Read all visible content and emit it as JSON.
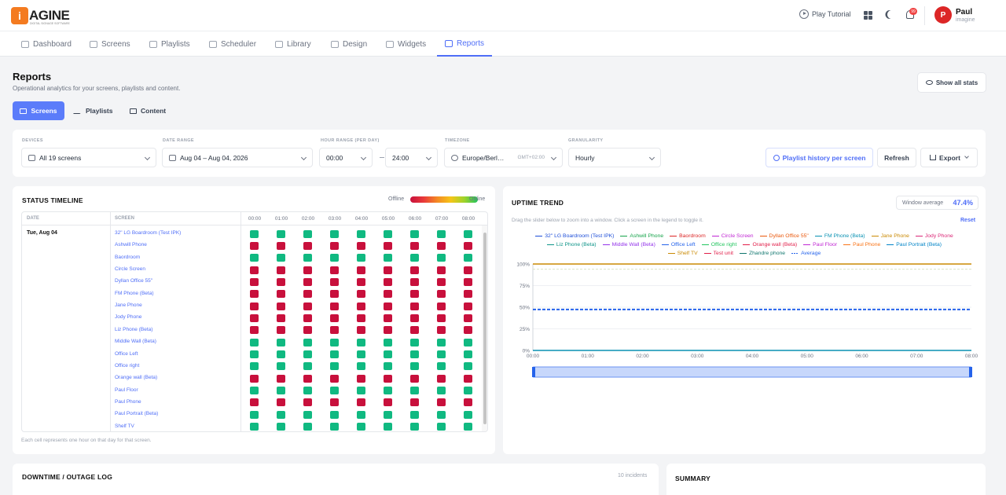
{
  "app": {
    "logo_text": "AGINE",
    "logo_mark": "i",
    "logo_sub": "DIGITAL SIGNAGE SOFTWARE"
  },
  "header": {
    "play_tutorial": "Play Tutorial",
    "notif_count": "99",
    "user_initial": "P",
    "user_name": "Paul",
    "user_org": "imagine"
  },
  "nav": {
    "items": [
      "Dashboard",
      "Screens",
      "Playlists",
      "Scheduler",
      "Library",
      "Design",
      "Widgets",
      "Reports"
    ],
    "active": "Reports"
  },
  "page": {
    "title": "Reports",
    "subtitle": "Operational analytics for your screens, playlists and content.",
    "show_all": "Show all stats"
  },
  "type_tabs": [
    "Screens",
    "Playlists",
    "Content"
  ],
  "filters": {
    "devices_label": "DEVICES",
    "devices_value": "All 19 screens",
    "date_label": "DATE RANGE",
    "date_value": "Aug 04 – Aug 04, 2026",
    "hour_label": "HOUR RANGE (PER DAY)",
    "hour_from": "00:00",
    "hour_to": "24:00",
    "tz_label": "TIMEZONE",
    "tz_value": "Europe/Berl…",
    "tz_offset": "GMT+02:00",
    "gran_label": "GRANULARITY",
    "gran_value": "Hourly",
    "history_btn": "Playlist history per screen",
    "refresh_btn": "Refresh",
    "export_btn": "Export"
  },
  "timeline": {
    "title": "STATUS TIMELINE",
    "legend_offline": "Offline",
    "legend_online": "Online",
    "col_date": "DATE",
    "col_screen": "SCREEN",
    "date": "Tue, Aug 04",
    "hours": [
      "00:00",
      "01:00",
      "02:00",
      "03:00",
      "04:00",
      "05:00",
      "06:00",
      "07:00",
      "08:00"
    ],
    "screens": [
      {
        "name": "32\" LG Boardroom (Test IPK)",
        "online": true
      },
      {
        "name": "Ashwill Phone",
        "online": false
      },
      {
        "name": "Baordroom",
        "online": true
      },
      {
        "name": "Circle Screen",
        "online": false
      },
      {
        "name": "Dyllan Office 55\"",
        "online": false
      },
      {
        "name": "FM Phone (Beta)",
        "online": false
      },
      {
        "name": "Jane Phone",
        "online": false
      },
      {
        "name": "Jody Phone",
        "online": false
      },
      {
        "name": "Liz Phone (Beta)",
        "online": false
      },
      {
        "name": "Middle Wall (Beta)",
        "online": true
      },
      {
        "name": "Office Left",
        "online": true
      },
      {
        "name": "Office right",
        "online": true
      },
      {
        "name": "Orange wall (Beta)",
        "online": false
      },
      {
        "name": "Paul Floor",
        "online": true
      },
      {
        "name": "Paul Phone",
        "online": false
      },
      {
        "name": "Paul Portrait (Beta)",
        "online": true
      },
      {
        "name": "Shelf TV",
        "online": true
      }
    ],
    "footnote": "Each cell represents one hour on that day for that screen."
  },
  "uptime": {
    "title": "UPTIME TREND",
    "window_avg_label": "Window average",
    "window_avg_value": "47.4%",
    "hint": "Drag the slider below to zoom into a window. Click a screen in the legend to toggle it.",
    "reset": "Reset",
    "legend_rows": [
      [
        {
          "name": "32\" LG Boardroom (Test IPK)",
          "color": "#1d4ed8"
        },
        {
          "name": "Ashwill Phone",
          "color": "#16a34a"
        },
        {
          "name": "Baordroom",
          "color": "#dc2626"
        },
        {
          "name": "Circle Screen",
          "color": "#c026d3"
        },
        {
          "name": "Dyllan Office 55\"",
          "color": "#ea580c"
        },
        {
          "name": "FM Phone (Beta)",
          "color": "#0891b2"
        },
        {
          "name": "Jane Phone",
          "color": "#ca8a04"
        },
        {
          "name": "Jody Phone",
          "color": "#db2777"
        }
      ],
      [
        {
          "name": "Liz Phone (Beta)",
          "color": "#0d9488"
        },
        {
          "name": "Middle Wall (Beta)",
          "color": "#9333ea"
        },
        {
          "name": "Office Left",
          "color": "#2563eb"
        },
        {
          "name": "Office right",
          "color": "#22c55e"
        },
        {
          "name": "Orange wall (Beta)",
          "color": "#e11d48"
        },
        {
          "name": "Paul Floor",
          "color": "#c026d3"
        },
        {
          "name": "Paul Phone",
          "color": "#f97316"
        },
        {
          "name": "Paul Portrait (Beta)",
          "color": "#0284c7"
        }
      ],
      [
        {
          "name": "Shelf TV",
          "color": "#ca8a04"
        },
        {
          "name": "Test unit",
          "color": "#e11d48"
        },
        {
          "name": "Zhandre phone",
          "color": "#0f766e"
        },
        {
          "name": "Average",
          "color": "#2563eb",
          "dashed": true
        }
      ]
    ],
    "y_ticks": [
      "100%",
      "75%",
      "50%",
      "25%",
      "0%"
    ],
    "x_ticks": [
      "00:00",
      "01:00",
      "02:00",
      "03:00",
      "04:00",
      "05:00",
      "06:00",
      "07:00",
      "08:00"
    ]
  },
  "chart_data": {
    "type": "line",
    "x": [
      "00:00",
      "01:00",
      "02:00",
      "03:00",
      "04:00",
      "05:00",
      "06:00",
      "07:00",
      "08:00"
    ],
    "ylim": [
      0,
      100
    ],
    "series": [
      {
        "name": "Shelf TV",
        "values": [
          100,
          100,
          100,
          100,
          100,
          100,
          100,
          100,
          100
        ]
      },
      {
        "name": "Average",
        "values": [
          47.4,
          47.4,
          47.4,
          47.4,
          47.4,
          47.4,
          47.4,
          47.4,
          47.4
        ]
      },
      {
        "name": "FM Phone (Beta)",
        "values": [
          0,
          0,
          0,
          0,
          0,
          0,
          0,
          0,
          0
        ]
      }
    ]
  },
  "bottom": {
    "downtime_title": "DOWNTIME / OUTAGE LOG",
    "incidents": "10 incidents",
    "summary_title": "SUMMARY"
  }
}
